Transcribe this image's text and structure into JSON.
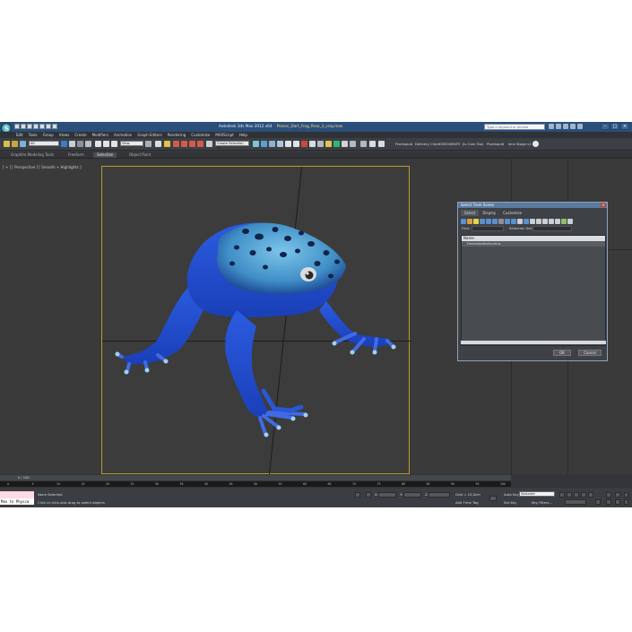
{
  "window": {
    "app_title": "Autodesk 3ds Max 2012 x64",
    "file_name": "Poison_Dart_Frog_Pose_3_vray.max",
    "search_placeholder": "Type a keyword or phrase",
    "controls": [
      "–",
      "□",
      "×"
    ]
  },
  "menu": [
    "Edit",
    "Tools",
    "Group",
    "Views",
    "Create",
    "Modifiers",
    "Animation",
    "Graph Editors",
    "Rendering",
    "Customize",
    "MAXScript",
    "Help"
  ],
  "toolbar": {
    "selection_filter": "All",
    "reference_coord": "View",
    "named_selection": "Create Selection Se",
    "right_items": [
      "Pixelsquid",
      "Delivery Check",
      "CHECKMATE",
      "Jiu Cam Tool",
      "Pixelsquid",
      "lens Stage v1"
    ]
  },
  "ribbon_tabs": [
    "Graphite Modeling Tools",
    "Freeform",
    "Selection",
    "Object Paint"
  ],
  "ribbon_active": "Selection",
  "viewport": {
    "label": "[ + ] [ Perspective ] [ Smooth + Highlights ]"
  },
  "select_from_scene": {
    "title": "Select From Scene",
    "tabs": [
      "Select",
      "Display",
      "Customize"
    ],
    "find_label": "Find:",
    "selection_set_label": "Selection Set:",
    "column_header": "Name",
    "row": "DendrobatesAzureus",
    "ok": "OK",
    "cancel": "Cancel"
  },
  "timeline": {
    "slider_label": "0 / 100",
    "ticks": [
      "0",
      "5",
      "10",
      "15",
      "20",
      "25",
      "30",
      "35",
      "40",
      "45",
      "50",
      "55",
      "60",
      "65",
      "70",
      "75",
      "80",
      "85",
      "90",
      "95",
      "100"
    ]
  },
  "status": {
    "maxscript_text": "Max to Physca",
    "selection_status": "None Selected",
    "prompt": "Click or click-and-drag to select objects",
    "grid": "Grid = 10,0cm",
    "add_time_tag": "Add Time Tag",
    "auto_key": "Auto Key",
    "set_key": "Set Key",
    "selected_option": "Selected",
    "key_filters": "Key Filters..."
  },
  "colors": {
    "frog_body": "#1f4fd0",
    "frog_back": "#4aa2d8",
    "safe_frame": "#b89c2a",
    "viewport_bg": "#3c3c3c"
  }
}
